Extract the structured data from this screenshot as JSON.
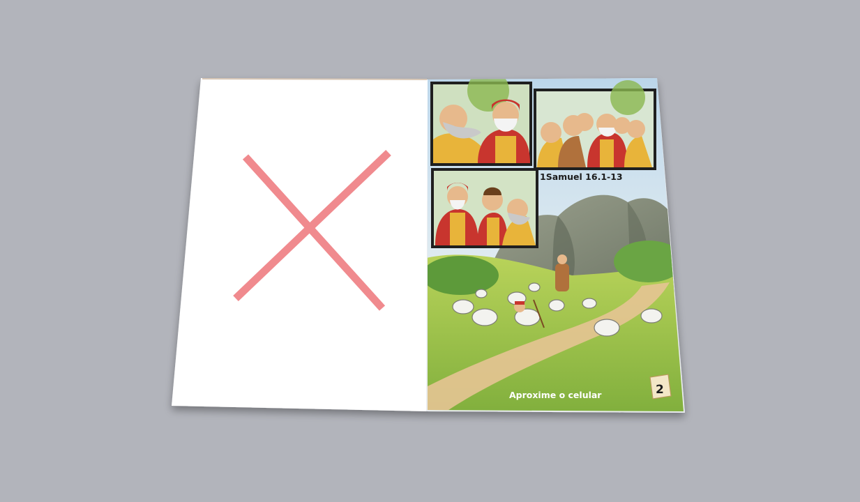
{
  "scene": {
    "description_kind": "photo of an open children's booklet",
    "left_page_mark": "red-x-mark",
    "colors": {
      "background": "#b2b4bb",
      "blank_page": "#ffffff",
      "x_mark": "#f08a8e",
      "panel_border": "#222222",
      "grass": "#a9c94a",
      "sky": "#cfe3ef",
      "path": "#e8c99a",
      "robe_red": "#c8352e",
      "robe_yellow": "#e8b43a"
    }
  },
  "right_page": {
    "reference": "1Samuel 16.1-13",
    "prompt": "Aproxime o celular",
    "page_number": "2"
  }
}
